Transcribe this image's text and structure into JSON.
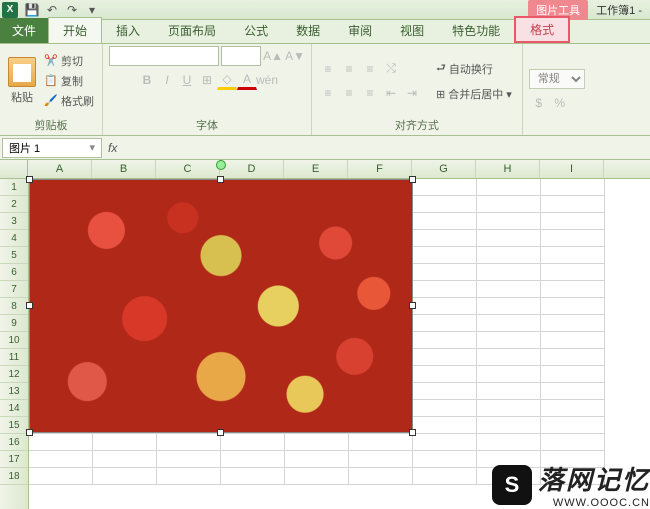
{
  "titlebar": {
    "context_tab": "图片工具",
    "workbook": "工作簿1 -"
  },
  "tabs": {
    "file": "文件",
    "home": "开始",
    "insert": "插入",
    "layout": "页面布局",
    "formulas": "公式",
    "data": "数据",
    "review": "审阅",
    "view": "视图",
    "special": "特色功能",
    "format": "格式"
  },
  "ribbon": {
    "clipboard": {
      "label": "剪贴板",
      "paste": "粘贴",
      "cut": "剪切",
      "copy": "复制",
      "format_painter": "格式刷"
    },
    "font": {
      "label": "字体"
    },
    "alignment": {
      "label": "对齐方式",
      "wrap": "自动换行",
      "merge": "合并后居中"
    },
    "number": {
      "default": "常规"
    }
  },
  "formula_bar": {
    "name_box": "图片 1",
    "fx": "fx"
  },
  "grid": {
    "columns": [
      "A",
      "B",
      "C",
      "D",
      "E",
      "F",
      "G",
      "H",
      "I"
    ],
    "rows": [
      "1",
      "2",
      "3",
      "4",
      "5",
      "6",
      "7",
      "8",
      "9",
      "10",
      "11",
      "12",
      "13",
      "14",
      "15",
      "16",
      "17",
      "18"
    ]
  },
  "watermark": {
    "icon": "S",
    "main": "落网记忆",
    "sub": "WWW.OOOC.CN"
  }
}
